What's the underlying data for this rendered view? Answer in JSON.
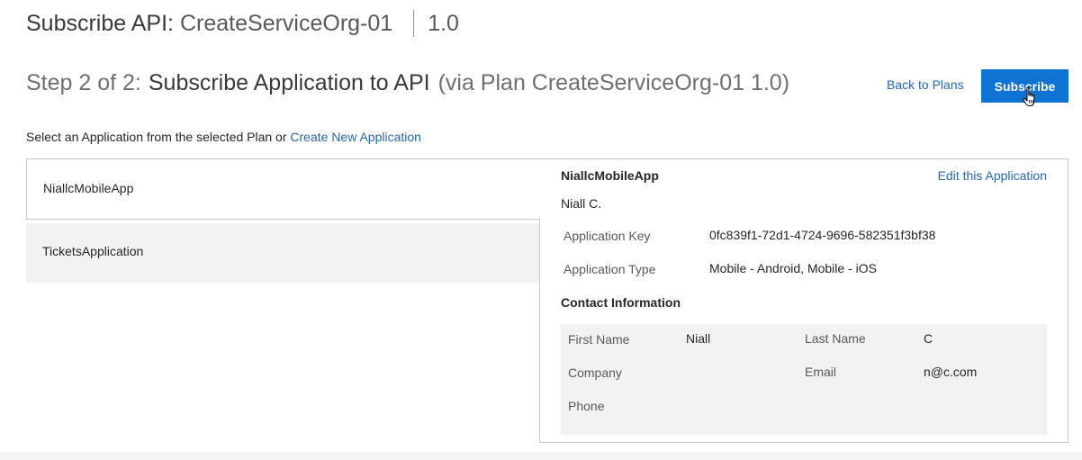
{
  "header": {
    "title_prefix": "Subscribe API:",
    "api_name": "CreateServiceOrg-01",
    "version": "1.0"
  },
  "step": {
    "prefix": "Step 2 of 2:",
    "title": "Subscribe Application to API",
    "suffix": "(via Plan CreateServiceOrg-01 1.0)"
  },
  "actions": {
    "back_label": "Back to Plans",
    "subscribe_label": "Subscribe"
  },
  "instruction": {
    "text": "Select an Application from the selected Plan or",
    "create_link": "Create New Application"
  },
  "applications": [
    {
      "name": "NiallcMobileApp",
      "selected": true
    },
    {
      "name": "TicketsApplication",
      "selected": false
    }
  ],
  "detail": {
    "name": "NiallcMobileApp",
    "edit_label": "Edit this Application",
    "owner": "Niall C.",
    "app_key_label": "Application Key",
    "app_key_value": "0fc839f1-72d1-4724-9696-582351f3bf38",
    "app_type_label": "Application Type",
    "app_type_value": "Mobile - Android, Mobile - iOS",
    "contact_heading": "Contact Information",
    "contact": {
      "first_name_label": "First Name",
      "first_name_value": "Niall",
      "last_name_label": "Last Name",
      "last_name_value": "C",
      "company_label": "Company",
      "company_value": "",
      "email_label": "Email",
      "email_value": "n@c.com",
      "phone_label": "Phone",
      "phone_value": ""
    }
  },
  "colors": {
    "primary_button": "#0f73d3",
    "link": "#2567b3",
    "panel_gray": "#f2f2f2"
  },
  "icons": {
    "cursor": "hand-pointer-icon"
  }
}
